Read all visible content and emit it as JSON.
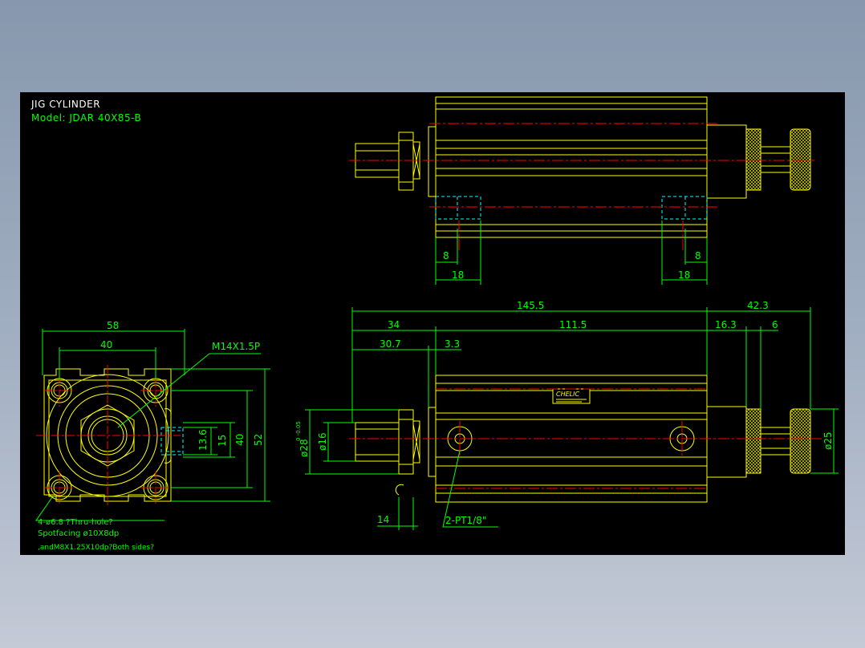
{
  "drawing": {
    "title": "JIG CYLINDER",
    "model": "Model:  JDAR 40X85-B"
  },
  "front_view": {
    "dim_58": "58",
    "dim_40_top": "40",
    "thread_label": "M14X1.5P",
    "dim_13_6": "13.6",
    "dim_15": "15",
    "dim_40_side": "40",
    "dim_52": "52",
    "note_1": "4-ø6.8 ?Thru-hole?",
    "note_2": "Spotfacing  ø10X8dp",
    "note_3": ",andM8X1.25X10dp?Both sides?"
  },
  "top_view": {
    "dim_8_left": "8",
    "dim_18_left": "18",
    "dim_8_right": "8",
    "dim_18_right": "18"
  },
  "side_view": {
    "dim_145_5": "145.5",
    "dim_42_3": "42.3",
    "dim_34": "34",
    "dim_111_5": "111.5",
    "dim_16_3": "16.3",
    "dim_6": "6",
    "dim_30_7": "30.7",
    "dim_3_3": "3.3",
    "dim_phi28": "ø28",
    "tolerance": "0\n-0.05",
    "dim_phi16": "ø16",
    "dim_phi25": "ø25",
    "dim_14": "14",
    "port_label": "2-PT1/8\"",
    "nameplate": "CHELIC"
  },
  "colors": {
    "background": "#000000",
    "outline": "#ffff00",
    "dimension": "#00ff00",
    "centerline": "#ff0000",
    "hidden": "#00ffff",
    "title": "#ffffff"
  }
}
